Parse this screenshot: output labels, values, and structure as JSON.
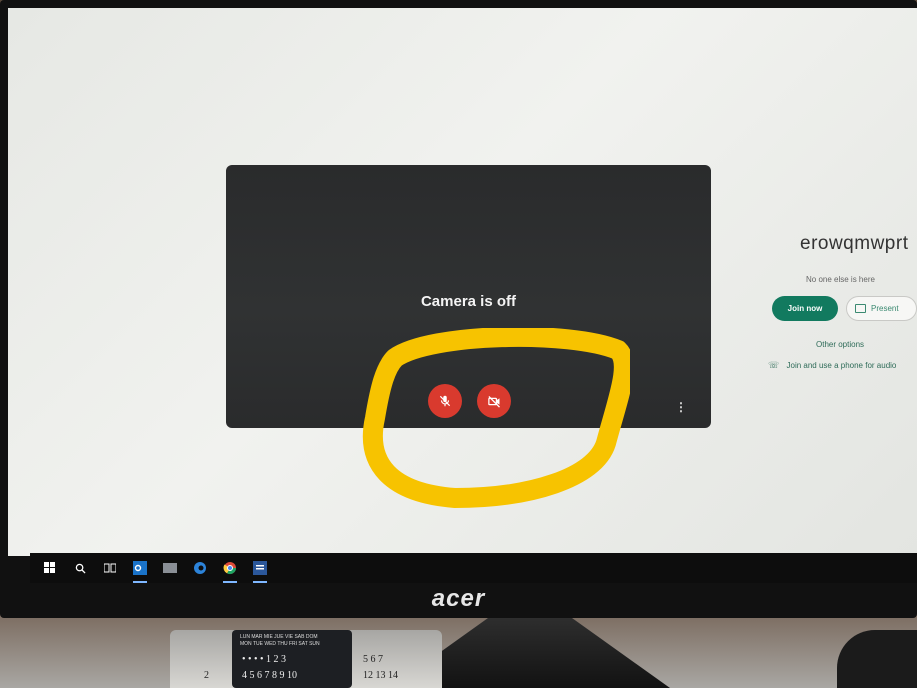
{
  "meeting": {
    "name": "erowqmwprt",
    "status": "No one else is here",
    "join_label": "Join now",
    "present_label": "Present",
    "other_options": "Other options",
    "phone_audio": "Join and use a phone for audio"
  },
  "preview": {
    "camera_status": "Camera is off",
    "mic_icon": "mic-off-icon",
    "cam_icon": "camera-off-icon",
    "more_icon": "more-vert-icon",
    "mic_color": "#d93a2e",
    "cam_color": "#d93a2e"
  },
  "taskbar": {
    "icons": [
      "windows-start-icon",
      "search-icon",
      "task-view-icon",
      "outlook-icon",
      "keyboard-icon",
      "edge-icon",
      "chrome-icon",
      "word-icon"
    ]
  },
  "monitor": {
    "brand": "acer"
  },
  "calendar": {
    "header": "LUN MAR MIE JUE VIE SAB DOM",
    "header2": "MON TUE WED THU FRI SAT SUN",
    "row1": "• • • • 1 2 3",
    "row2": "4 5 6 7 8 9 10",
    "side1": "5 6 7",
    "side2": "12 13 14",
    "left": "2"
  },
  "colors": {
    "join_button": "#127a5f",
    "highlight": "#f7c300"
  }
}
